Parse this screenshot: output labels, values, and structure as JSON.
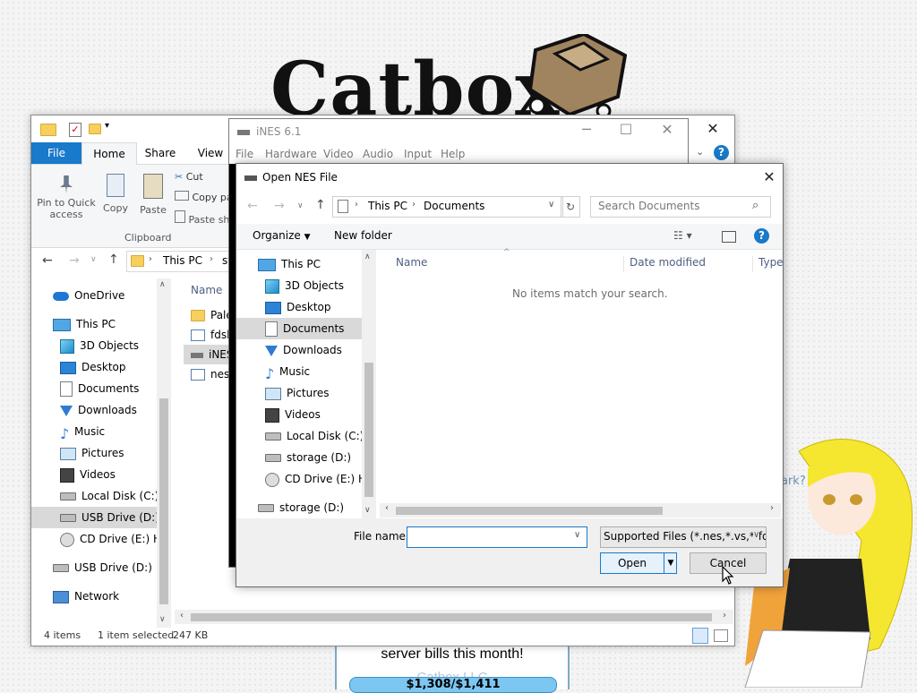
{
  "website": {
    "logo_text": "Catbox",
    "banner_text": "server bills this month!",
    "footer_text": "Catbox LLC",
    "donation_text": "$1,308/$1,411",
    "side_text": "ark?"
  },
  "explorer": {
    "ribbon_tabs": [
      "File",
      "Home",
      "Share",
      "View"
    ],
    "ribbon_buttons": {
      "pin": "Pin to Quick access",
      "copy": "Copy",
      "paste": "Paste",
      "cut": "Cut",
      "copy_path": "Copy pa",
      "paste_shortcut": "Paste sh"
    },
    "clipboard_group": "Clipboard",
    "address": [
      "This PC",
      "st"
    ],
    "tree": [
      {
        "label": "OneDrive",
        "icon": "onedrive-icon"
      },
      {
        "label": "This PC",
        "icon": "computer-icon"
      },
      {
        "label": "3D Objects",
        "icon": "cube-icon"
      },
      {
        "label": "Desktop",
        "icon": "desktop-icon"
      },
      {
        "label": "Documents",
        "icon": "document-icon"
      },
      {
        "label": "Downloads",
        "icon": "download-icon"
      },
      {
        "label": "Music",
        "icon": "music-icon"
      },
      {
        "label": "Pictures",
        "icon": "pictures-icon"
      },
      {
        "label": "Videos",
        "icon": "video-icon"
      },
      {
        "label": "Local Disk (C:)",
        "icon": "drive-icon"
      },
      {
        "label": "USB Drive (D:)",
        "icon": "drive-icon"
      },
      {
        "label": "CD Drive (E:) HB",
        "icon": "cd-icon"
      },
      {
        "label": "USB Drive (D:)",
        "icon": "drive-icon"
      },
      {
        "label": "Network",
        "icon": "network-icon"
      }
    ],
    "column_name": "Name",
    "files": [
      "Pale",
      "fdsli",
      "iNES",
      "nesli"
    ],
    "status": {
      "count": "4 items",
      "selected": "1 item selected",
      "size": "247 KB"
    }
  },
  "ines": {
    "title": "iNES 6.1",
    "menu": [
      "File",
      "Hardware",
      "Video",
      "Audio",
      "Input",
      "Help"
    ]
  },
  "dialog": {
    "title": "Open NES File",
    "breadcrumb": [
      "This PC",
      "Documents"
    ],
    "search_placeholder": "Search Documents",
    "organize": "Organize",
    "new_folder": "New folder",
    "tree": [
      {
        "label": "This PC",
        "icon": "computer-icon"
      },
      {
        "label": "3D Objects",
        "icon": "cube-icon"
      },
      {
        "label": "Desktop",
        "icon": "desktop-icon"
      },
      {
        "label": "Documents",
        "icon": "document-icon"
      },
      {
        "label": "Downloads",
        "icon": "download-icon"
      },
      {
        "label": "Music",
        "icon": "music-icon"
      },
      {
        "label": "Pictures",
        "icon": "pictures-icon"
      },
      {
        "label": "Videos",
        "icon": "video-icon"
      },
      {
        "label": "Local Disk (C:)",
        "icon": "drive-icon"
      },
      {
        "label": "storage (D:)",
        "icon": "drive-icon"
      },
      {
        "label": "CD Drive (E:) HB",
        "icon": "cd-icon"
      },
      {
        "label": "storage (D:)",
        "icon": "drive-icon"
      }
    ],
    "columns": [
      "Name",
      "Date modified",
      "Type"
    ],
    "empty_message": "No items match your search.",
    "filename_label": "File name:",
    "filename_value": "",
    "filter": "Supported Files (*.nes,*.vs,*.fds,",
    "open": "Open",
    "cancel": "Cancel"
  },
  "colors": {
    "accent": "#1979ca",
    "selection": "#cce8ff",
    "file_tab": "#1979ca"
  }
}
